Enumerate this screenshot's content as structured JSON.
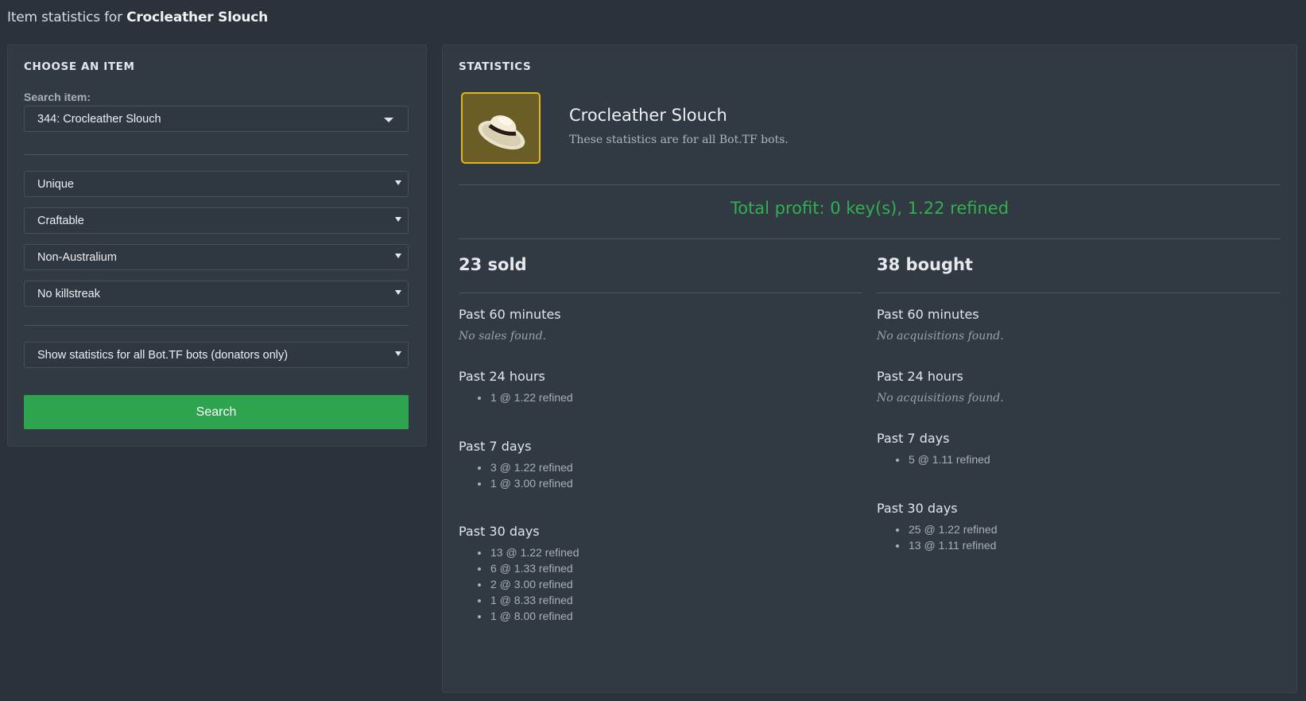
{
  "header": {
    "title_prefix": "Item statistics for",
    "item_name": "Crocleather Slouch"
  },
  "choose": {
    "heading": "CHOOSE AN ITEM",
    "search_label": "Search item:",
    "search_value": "344: Crocleather Slouch",
    "quality": "Unique",
    "craftable": "Craftable",
    "australium": "Non-Australium",
    "killstreak": "No killstreak",
    "scope": "Show statistics for all Bot.TF bots (donators only)",
    "search_button": "Search"
  },
  "stats": {
    "heading": "STATISTICS",
    "item_name": "Crocleather Slouch",
    "subtitle": "These statistics are for all Bot.TF bots.",
    "icon": "hat-icon",
    "total_profit": "Total profit: 0 key(s), 1.22 refined",
    "sold": {
      "title": "23 sold",
      "past_60_minutes": {
        "label": "Past 60 minutes",
        "empty": "No sales found."
      },
      "past_24_hours": {
        "label": "Past 24 hours",
        "items": [
          "1 @ 1.22 refined"
        ]
      },
      "past_7_days": {
        "label": "Past 7 days",
        "items": [
          "3 @ 1.22 refined",
          "1 @ 3.00 refined"
        ]
      },
      "past_30_days": {
        "label": "Past 30 days",
        "items": [
          "13 @ 1.22 refined",
          "6 @ 1.33 refined",
          "2 @ 3.00 refined",
          "1 @ 8.33 refined",
          "1 @ 8.00 refined"
        ]
      }
    },
    "bought": {
      "title": "38 bought",
      "past_60_minutes": {
        "label": "Past 60 minutes",
        "empty": "No acquisitions found."
      },
      "past_24_hours": {
        "label": "Past 24 hours",
        "empty": "No acquisitions found."
      },
      "past_7_days": {
        "label": "Past 7 days",
        "items": [
          "5 @ 1.11 refined"
        ]
      },
      "past_30_days": {
        "label": "Past 30 days",
        "items": [
          "25 @ 1.22 refined",
          "13 @ 1.11 refined"
        ]
      }
    }
  },
  "colors": {
    "accent_green": "#2ea44f",
    "profit_green": "#32b04f",
    "item_border": "#e0b520"
  }
}
